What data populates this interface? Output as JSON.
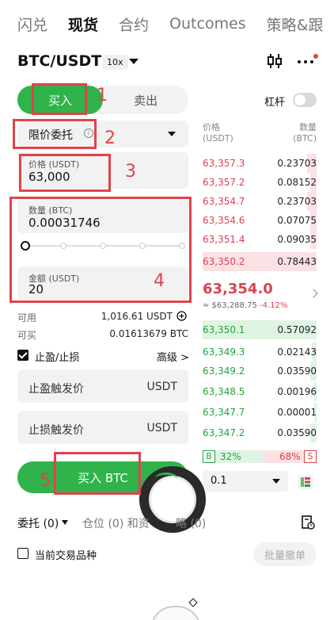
{
  "nav": {
    "tabs": [
      "闪兑",
      "现货",
      "合约",
      "Outcomes",
      "策略&跟"
    ]
  },
  "pair": {
    "name": "BTC/USDT",
    "leverage": "10x"
  },
  "toggle": {
    "buy": "买入",
    "sell": "卖出"
  },
  "margin": {
    "label": "杠杆"
  },
  "order_type": {
    "label": "限价委托",
    "info": "i"
  },
  "price_field": {
    "label": "价格 (USDT)",
    "value": "63,000"
  },
  "qty_field": {
    "label": "数量 (BTC)",
    "value": "0.00031746"
  },
  "amount_field": {
    "label": "金额 (USDT)",
    "value": "20"
  },
  "slider": {
    "level_percent": 0
  },
  "available": {
    "label": "可用",
    "value": "1,016.61 USDT"
  },
  "can_buy": {
    "label": "可买",
    "value": "0.01613679 BTC"
  },
  "tpsl": {
    "label": "止盈/止损",
    "advanced": "高级 >"
  },
  "tp_field": {
    "placeholder": "止盈触发价",
    "unit": "USDT"
  },
  "sl_field": {
    "placeholder": "止损触发价",
    "unit": "USDT"
  },
  "buy_button": {
    "label": "买入 BTC"
  },
  "orderbook": {
    "price_header_1": "价格",
    "price_header_2": "(USDT)",
    "qty_header_1": "数量",
    "qty_header_2": "(BTC)",
    "asks": [
      {
        "price": "63,357.3",
        "qty": "0.23703"
      },
      {
        "price": "63,357.2",
        "qty": "0.08152"
      },
      {
        "price": "63,354.7",
        "qty": "0.23703"
      },
      {
        "price": "63,354.6",
        "qty": "0.07075"
      },
      {
        "price": "63,351.4",
        "qty": "0.09035"
      },
      {
        "price": "63,350.2",
        "qty": "0.78443"
      }
    ],
    "last_price": "63,354.0",
    "ref_price": "≈ $63,288.75",
    "change": "-4.12%",
    "bids": [
      {
        "price": "63,350.1",
        "qty": "0.57092"
      },
      {
        "price": "63,349.3",
        "qty": "0.02143"
      },
      {
        "price": "63,349.2",
        "qty": "0.03590"
      },
      {
        "price": "63,348.5",
        "qty": "0.00196"
      },
      {
        "price": "63,347.7",
        "qty": "0.00001"
      },
      {
        "price": "63,347.2",
        "qty": "0.03590"
      }
    ],
    "buy_label": "B",
    "buy_ratio": "32%",
    "sell_ratio": "68%",
    "sell_label": "S",
    "precision": "0.1"
  },
  "bottom_tabs": {
    "orders": "委托 (0)",
    "positions": "仓位 (0) 和资",
    "strategies": "略 (0)"
  },
  "current_pair": {
    "label": "当前交易品种"
  },
  "batch_cancel": {
    "label": "批量撤单"
  },
  "annotations": [
    "1",
    "2",
    "3",
    "4",
    "5"
  ],
  "colors": {
    "buy": "#2fb34a",
    "ask": "#d9434f",
    "bid": "#20a53d",
    "annotation": "#e0434b"
  }
}
